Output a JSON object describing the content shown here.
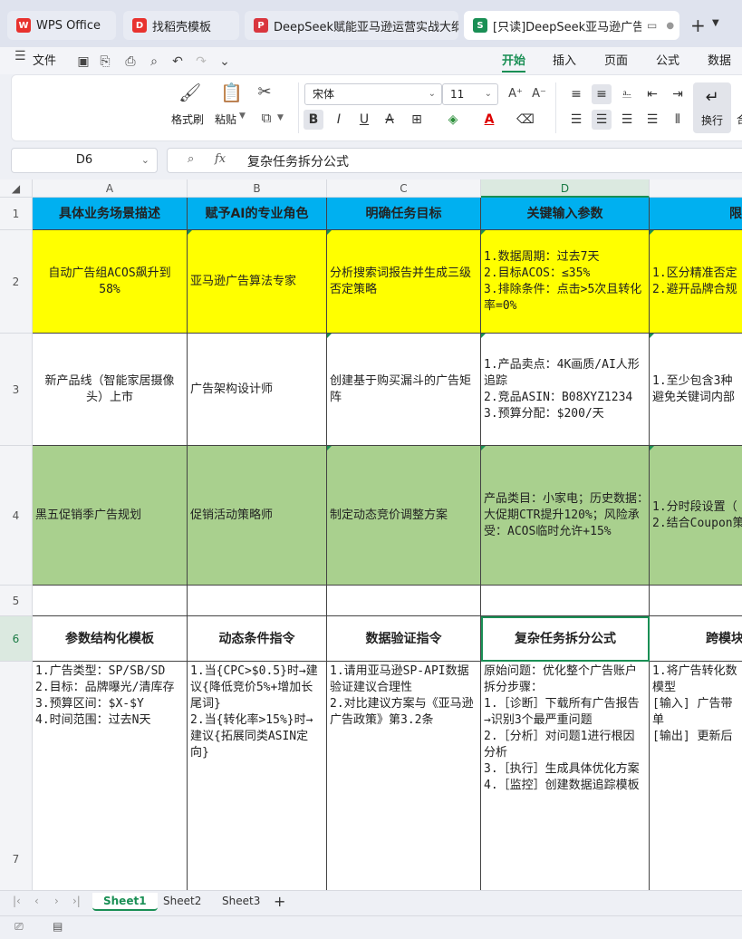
{
  "tabs": [
    {
      "label": "WPS Office"
    },
    {
      "label": "找稻壳模板"
    },
    {
      "label": "DeepSeek赋能亚马逊运营实战大纲(1"
    },
    {
      "label": "[只读]DeepSeek亚马逊广告运"
    }
  ],
  "menu": {
    "file": "文件",
    "items": [
      "开始",
      "插入",
      "页面",
      "公式",
      "数据"
    ]
  },
  "ribbon": {
    "format_painter": "格式刷",
    "paste": "粘贴",
    "font_name": "宋体",
    "font_size": "11",
    "wrap": "换行",
    "merge_partial": "合"
  },
  "formula_bar": {
    "cell_ref": "D6",
    "fx": "fx",
    "content": "复杂任务拆分公式"
  },
  "columns": [
    "A",
    "B",
    "C",
    "D"
  ],
  "rows": [
    "1",
    "2",
    "3",
    "4",
    "5",
    "6",
    "7"
  ],
  "row1": [
    "具体业务场景描述",
    "赋予AI的专业角色",
    "明确任务目标",
    "关键输入参数",
    "限"
  ],
  "row2": [
    "自动广告组ACOS飙升到58%",
    "亚马逊广告算法专家",
    "分析搜索词报告并生成三级否定策略",
    "1.数据周期：过去7天\n2.目标ACOS：≤35%\n3.排除条件：点击>5次且转化率=0%",
    "1.区分精准否定\n2.避开品牌合规"
  ],
  "row3": [
    "新产品线（智能家居摄像头）上市",
    "广告架构设计师",
    "创建基于购买漏斗的广告矩阵",
    "1.产品卖点：4K画质/AI人形追踪\n2.竞品ASIN：B08XYZ1234\n3.预算分配：$200/天",
    "1.至少包含3种\n避免关键词内部"
  ],
  "row4": [
    "黑五促销季广告规划",
    "促销活动策略师",
    "制定动态竞价调整方案",
    "产品类目：小家电；历史数据：大促期CTR提升120%；风险承受：ACOS临时允许+15%",
    "1.分时段设置（\n2.结合Coupon策"
  ],
  "row6": [
    "参数结构化模板",
    "动态条件指令",
    "数据验证指令",
    "复杂任务拆分公式",
    "跨模块"
  ],
  "row7": [
    "1.广告类型：SP/SB/SD\n2.目标：品牌曝光/清库存\n3.预算区间：$X-$Y\n4.时间范围：过去N天",
    "1.当{CPC>$0.5}时→建议{降低竞价5%+增加长尾词}\n2.当{转化率>15%}时→建议{拓展同类ASIN定向}",
    "1.请用亚马逊SP-API数据验证建议合理性\n2.对比建议方案与《亚马逊广告政策》第3.2条",
    "原始问题：优化整个广告账户\n拆分步骤：\n1.［诊断］下载所有广告报告→识别3个最严重问题\n2.［分析］对问题1进行根因分析\n3.［执行］生成具体优化方案\n4.［监控］创建数据追踪模板",
    "1.将广告转化数\n模型\n[输入] 广告带\n单\n[输出] 更新后"
  ],
  "sheets": [
    "Sheet1",
    "Sheet2",
    "Sheet3"
  ],
  "colors": {
    "header_blue": "#00b0f0",
    "yellow": "#ffff00",
    "green": "#a9d08e",
    "accent": "#1a8f55"
  }
}
